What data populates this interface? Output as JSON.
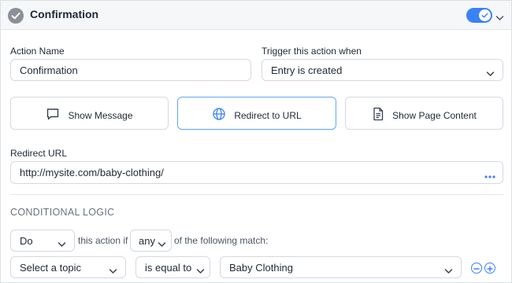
{
  "header": {
    "title": "Confirmation",
    "enabled": true
  },
  "action_name": {
    "label": "Action Name",
    "value": "Confirmation"
  },
  "trigger": {
    "label": "Trigger this action when",
    "value": "Entry is created"
  },
  "action_types": [
    {
      "label": "Show Message",
      "icon": "message-icon",
      "selected": false
    },
    {
      "label": "Redirect to URL",
      "icon": "globe-icon",
      "selected": true
    },
    {
      "label": "Show Page Content",
      "icon": "document-icon",
      "selected": false
    }
  ],
  "redirect": {
    "label": "Redirect URL",
    "value": "http://mysite.com/baby-clothing/"
  },
  "conditional": {
    "title": "CONDITIONAL LOGIC",
    "action_value": "Do",
    "text_before": "this action if",
    "match_value": "any",
    "text_after": "of the following match:",
    "rule": {
      "field": "Select a topic",
      "operator": "is equal to",
      "value": "Baby Clothing"
    }
  },
  "colors": {
    "accent": "#3b82f6",
    "border": "#d5d9de",
    "header_bg": "#f6f7f9"
  }
}
